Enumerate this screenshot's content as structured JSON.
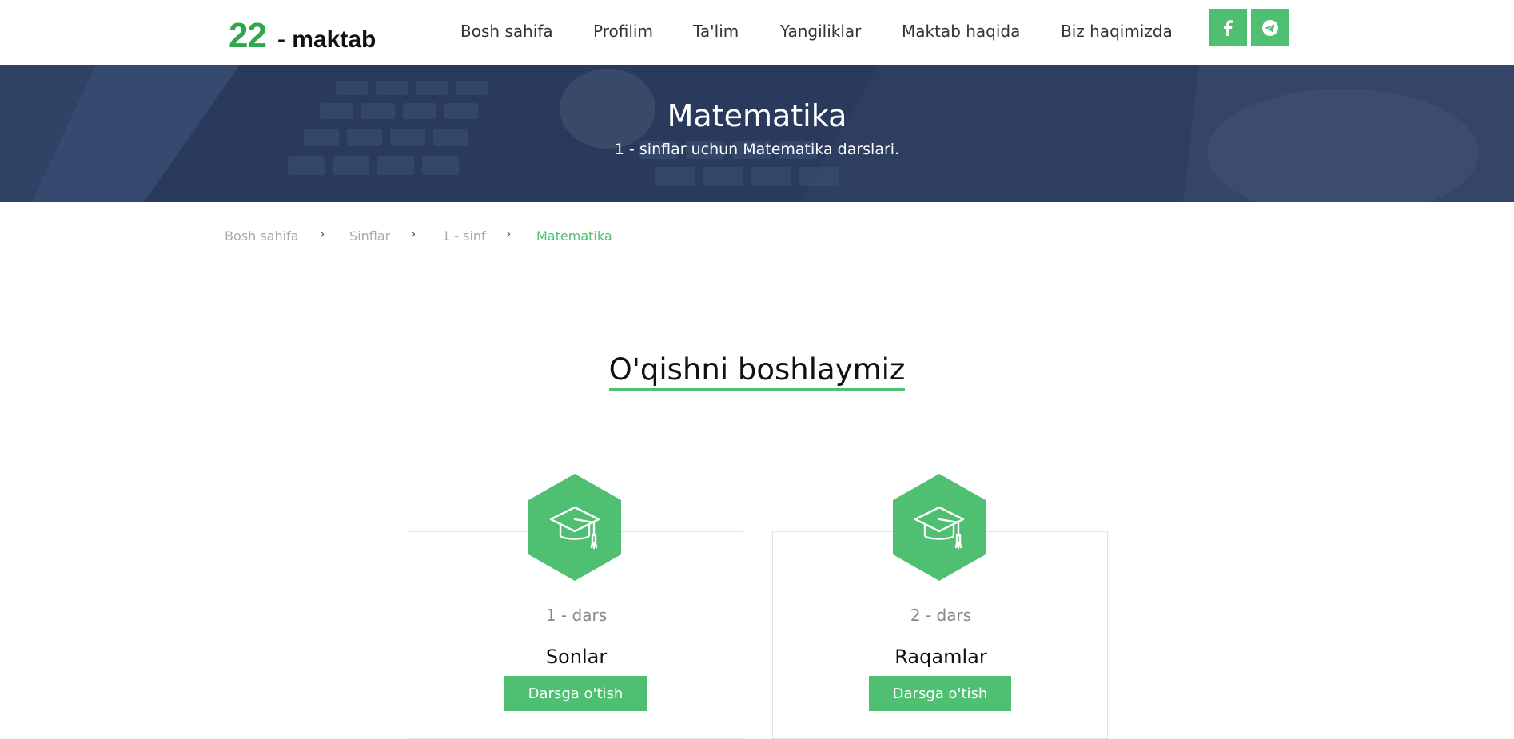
{
  "logo": {
    "number": "22",
    "text": "- maktab"
  },
  "nav": {
    "items": [
      {
        "label": "Bosh sahifa"
      },
      {
        "label": "Profilim"
      },
      {
        "label": "Ta'lim"
      },
      {
        "label": "Yangiliklar"
      },
      {
        "label": "Maktab haqida"
      },
      {
        "label": "Biz haqimizda"
      }
    ],
    "social": [
      {
        "icon": "facebook-icon"
      },
      {
        "icon": "telegram-icon"
      }
    ]
  },
  "hero": {
    "title": "Matematika",
    "subtitle": "1 - sinflar uchun Matematika darslari."
  },
  "breadcrumb": {
    "items": [
      {
        "label": "Bosh sahifa"
      },
      {
        "label": "Sinflar"
      },
      {
        "label": "1 - sinf"
      },
      {
        "label": "Matematika"
      }
    ],
    "separator": "›"
  },
  "section": {
    "title": "O'qishni boshlaymiz"
  },
  "lessons": [
    {
      "number": "1 - dars",
      "title": "Sonlar",
      "button": "Darsga o'tish",
      "icon": "graduation-cap-icon"
    },
    {
      "number": "2 - dars",
      "title": "Raqamlar",
      "button": "Darsga o'tish",
      "icon": "graduation-cap-icon"
    }
  ],
  "colors": {
    "accent": "#4fbf72",
    "logo_green": "#2ea84a",
    "hero_overlay": "#2d3f62"
  }
}
